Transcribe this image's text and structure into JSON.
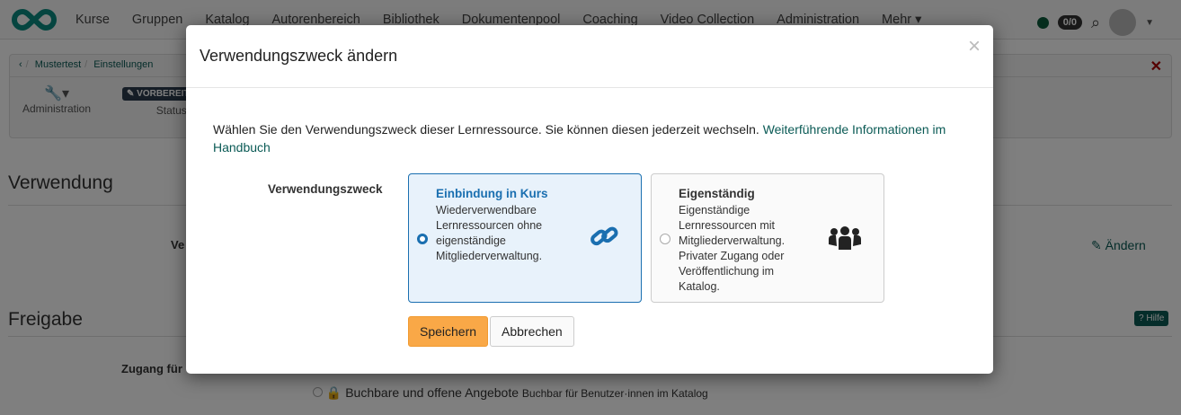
{
  "nav": {
    "items": [
      "Kurse",
      "Gruppen",
      "Katalog",
      "Autorenbereich",
      "Bibliothek",
      "Dokumentenpool",
      "Coaching",
      "Video Collection",
      "Administration",
      "Mehr ▾"
    ],
    "badge": "0/0",
    "status_color": "#0a5a3a",
    "brand_color": "#0a8a80"
  },
  "toolbar": {
    "breadcrumb": [
      "Mustertest",
      "Einstellungen"
    ],
    "admin_label": "Administration",
    "status_badge": "✎ VORBEREIT",
    "status_label": "Status"
  },
  "page": {
    "section1": "Verwendung",
    "field1": "Ve",
    "edit_label": "Ändern",
    "section2": "Freigabe",
    "help_label": "Hilfe",
    "access_label": "Zugang für",
    "option_label": "Buchbare und offene Angebote",
    "option_hint": "Buchbar für Benutzer·innen im Katalog"
  },
  "modal": {
    "title": "Verwendungszweck ändern",
    "close": "×",
    "intro": "Wählen Sie den Verwendungszweck dieser Lernressource. Sie können diesen jederzeit wechseln. ",
    "intro_link": "Weiterführende Informationen im Handbuch",
    "field_label": "Verwendungszweck",
    "options": [
      {
        "title": "Einbindung in Kurs",
        "desc": "Wiederverwendbare Lernressourcen ohne eigenständige Mitgliederverwaltung.",
        "selected": true,
        "icon": "link-icon"
      },
      {
        "title": "Eigenständig",
        "desc": "Eigenständige Lernressourcen mit Mitgliederverwaltung. Privater Zugang oder Veröffentlichung im Katalog.",
        "selected": false,
        "icon": "group-icon"
      }
    ],
    "save": "Speichern",
    "cancel": "Abbrechen",
    "accent": "#1a6fb0",
    "primary_color": "#f9a847"
  }
}
